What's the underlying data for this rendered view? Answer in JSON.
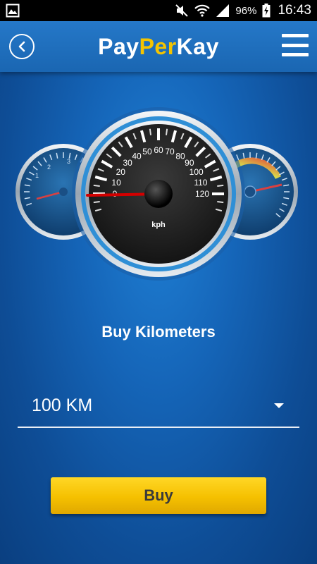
{
  "status_bar": {
    "battery": "96%",
    "time": "16:43"
  },
  "header": {
    "logo": {
      "part1": "Pay",
      "part2": "Per",
      "part3": "Kay"
    }
  },
  "gauge": {
    "speed_labels": [
      "0",
      "10",
      "20",
      "30",
      "40",
      "50",
      "60",
      "70",
      "80",
      "90",
      "100",
      "110",
      "120"
    ],
    "unit": "kph",
    "left_ticks": [
      "1",
      "2",
      "3"
    ]
  },
  "page": {
    "title": "Buy Kilometers"
  },
  "selector": {
    "value": "100 KM"
  },
  "actions": {
    "buy_label": "Buy"
  },
  "colors": {
    "accent_yellow": "#f5c400",
    "background_blue": "#1565b8",
    "needle_red": "#d40000"
  }
}
